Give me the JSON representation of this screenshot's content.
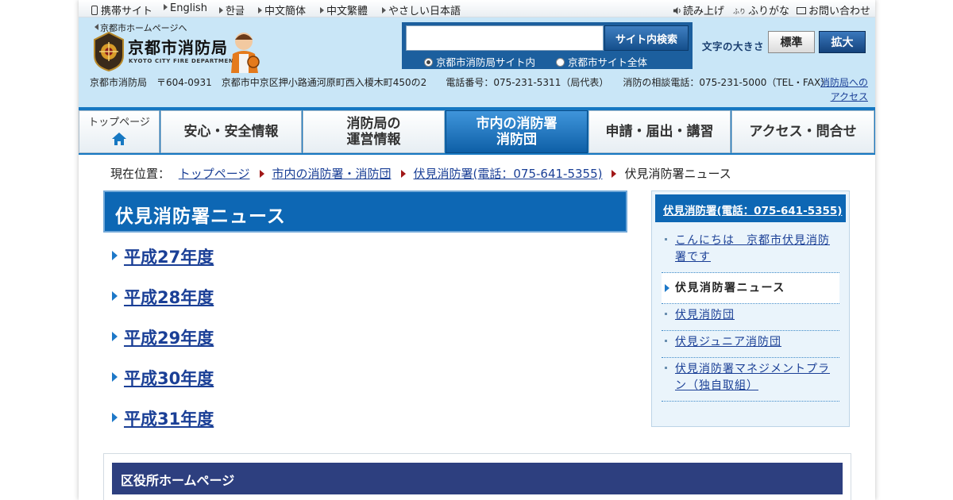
{
  "utility_bar": {
    "mobile": "携帯サイト",
    "english": "English",
    "korean": "한글",
    "chinese_simplified": "中文簡体",
    "chinese_traditional": "中文繁體",
    "easy_japanese": "やさしい日本語",
    "read_aloud": "読み上げ",
    "furigana": "ふりがな",
    "contact": "お問い合わせ",
    "furigana_icon_text": "ふり"
  },
  "header": {
    "city_home_link": "京都市ホームページへ",
    "logo_title": "京都市消防局",
    "logo_sub": "KYOTO CITY FIRE DEPARTMENT",
    "search": {
      "value": "",
      "button": "サイト内検索",
      "option_fire": "京都市消防局サイト内",
      "option_city": "京都市サイト全体"
    },
    "font_size_label": "文字の大きさ",
    "font_standard": "標準",
    "font_large": "拡大",
    "address": "京都市消防局　〒604-0931　京都市中京区押小路通河原町西入榎木町450の2　　電話番号：075-231-5311（局代表）　　消防の相談電話：075-231-5000（TEL・FAX）",
    "access_link": "消防局へのアクセス"
  },
  "nav": {
    "top": "トップページ",
    "safety": "安心・安全情報",
    "operations": "消防局の\n運営情報",
    "stations": "市内の消防署\n消防団",
    "applications": "申請・届出・講習",
    "access": "アクセス・問合せ"
  },
  "breadcrumb": {
    "label": "現在位置：",
    "items": [
      "トップページ",
      "市内の消防署・消防団",
      "伏見消防署(電話：075-641-5355)"
    ],
    "current": "伏見消防署ニュース"
  },
  "main": {
    "title": "伏見消防署ニュース",
    "years": [
      "平成27年度",
      "平成28年度",
      "平成29年度",
      "平成30年度",
      "平成31年度"
    ]
  },
  "sidebar": {
    "heading": "伏見消防署(電話：075-641-5355)",
    "items": [
      {
        "label": "こんにちは　京都市伏見消防署です",
        "current": false
      },
      {
        "label": "伏見消防署ニュース",
        "current": true
      },
      {
        "label": "伏見消防団",
        "current": false
      },
      {
        "label": "伏見ジュニア消防団",
        "current": false
      },
      {
        "label": "伏見消防署マネジメントプラン（独自取組）",
        "current": false
      }
    ]
  },
  "ward": {
    "heading": "区役所ホームページ"
  },
  "colors": {
    "nav_bar": "#1678c2",
    "title_blue": "#0d67b4",
    "link": "#1a3f96",
    "ward_head": "#2d3f7f",
    "header_bg": "#c9e6f7"
  }
}
